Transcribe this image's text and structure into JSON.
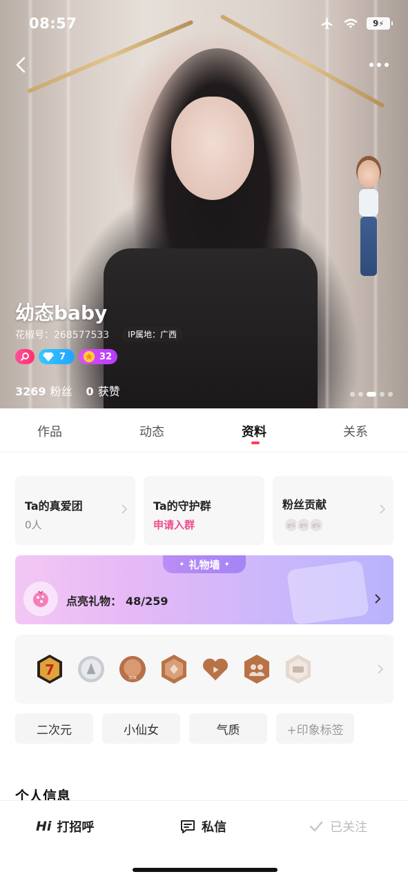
{
  "status_bar": {
    "time": "08:57",
    "battery": "9"
  },
  "profile": {
    "name": "幼态baby",
    "id_text": "花椒号：268577533",
    "ip_text": "IP属地：广西",
    "badges": [
      {
        "icon": "pink-badge-icon",
        "value": ""
      },
      {
        "icon": "diamond-icon",
        "value": "7"
      },
      {
        "icon": "star-icon",
        "value": "32"
      }
    ],
    "fans_count": "3269",
    "fans_label": "粉丝",
    "likes_count": "0",
    "likes_label": "获赞",
    "photo_page": "3",
    "photo_total": "5"
  },
  "tabs": [
    {
      "label": "作品"
    },
    {
      "label": "动态"
    },
    {
      "label": "资料"
    },
    {
      "label": "关系"
    }
  ],
  "active_tab": "资料",
  "cards": {
    "fan_club": {
      "title": "Ta的真爱团",
      "value": "0人"
    },
    "guard_group": {
      "title": "Ta的守护群",
      "action": "申请入群"
    },
    "contribution": {
      "title": "粉丝贡献",
      "avatars": [
        "虚位",
        "虚位",
        "虚位"
      ]
    }
  },
  "gift_wall": {
    "header": "礼物墙",
    "label": "点亮礼物：",
    "count": "48/259"
  },
  "medals": [
    {
      "icon": "lucky-7-medal-icon",
      "label": ""
    },
    {
      "icon": "silver-medal-icon",
      "label": ""
    },
    {
      "icon": "30k-medal-icon",
      "label": "30K"
    },
    {
      "icon": "hexagon-medal-icon",
      "label": ""
    },
    {
      "icon": "heart-play-medal-icon",
      "label": ""
    },
    {
      "icon": "people-medal-icon",
      "label": ""
    },
    {
      "icon": "locked-medal-icon",
      "label": ""
    }
  ],
  "tags": [
    "二次元",
    "小仙女",
    "气质",
    "+印象标签"
  ],
  "section_title": "个人信息",
  "bottom_bar": {
    "greet_mark": "Hi",
    "greet": "打招呼",
    "message": "私信",
    "follow": "已关注"
  },
  "colors": {
    "accent": "#ff3d55",
    "pink_text": "#ef4c8b"
  }
}
